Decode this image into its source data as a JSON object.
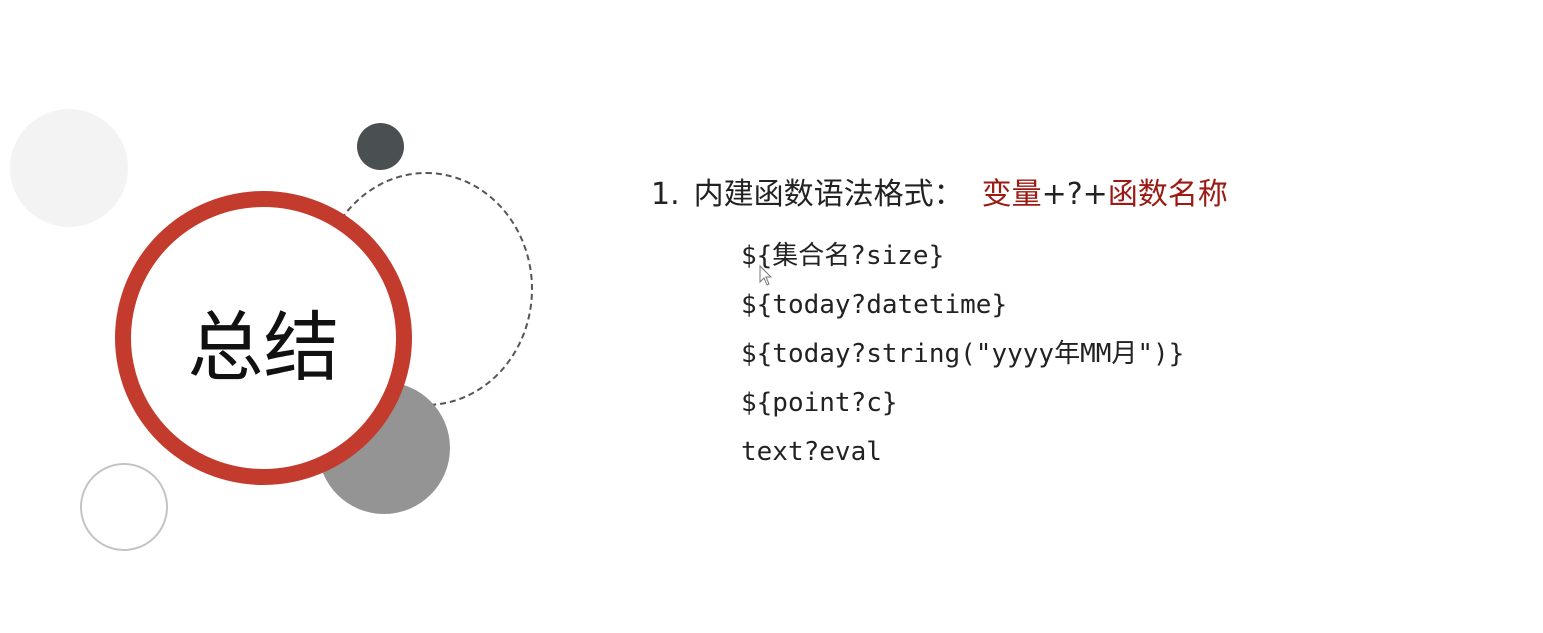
{
  "slide": {
    "title": "总结",
    "heading": {
      "number": "1.",
      "label": "内建函数语法格式：",
      "var_part": "变量",
      "join_part": "+?+",
      "func_part": "函数名称"
    },
    "code_lines": [
      "${集合名?size}",
      "${today?datetime}",
      "${today?string(\"yyyy年MM月\")}",
      "${point?c}",
      "text?eval"
    ]
  },
  "colors": {
    "accent_red": "#c33b2c",
    "text_red": "#9b1a13",
    "dark_gray": "#4a4f52",
    "mid_gray": "#949494",
    "light_gray": "#f3f3f3"
  }
}
